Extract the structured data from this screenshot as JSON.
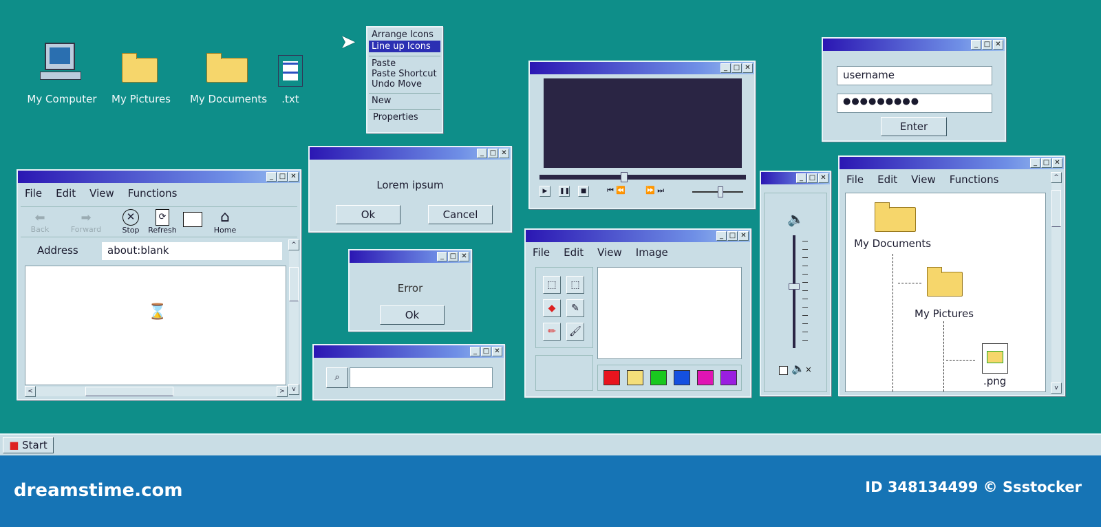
{
  "desktop_icons": [
    {
      "label": "My Computer"
    },
    {
      "label": "My Pictures"
    },
    {
      "label": "My Documents"
    },
    {
      "label": ".txt"
    }
  ],
  "context_menu": {
    "items": [
      "Arrange Icons",
      "Line up Icons",
      "Paste",
      "Paste Shortcut",
      "Undo Move",
      "New",
      "Properties"
    ]
  },
  "browser": {
    "menu": [
      "File",
      "Edit",
      "View",
      "Functions"
    ],
    "toolbar": [
      "Back",
      "Forward",
      "Stop",
      "Refresh",
      "Home"
    ],
    "address_label": "Address",
    "address_value": "about:blank"
  },
  "dialog": {
    "message": "Lorem ipsum",
    "ok": "Ok",
    "cancel": "Cancel"
  },
  "error": {
    "message": "Error",
    "ok": "Ok"
  },
  "search": {
    "value": ""
  },
  "player": {
    "progress": 0.41,
    "volume": 0.55
  },
  "paint": {
    "menu": [
      "File",
      "Edit",
      "View",
      "Image"
    ],
    "palette": [
      "#e8141e",
      "#f4de7a",
      "#19c81f",
      "#1450e0",
      "#e014b4",
      "#9a1ee0"
    ]
  },
  "volume": {
    "level": 0.55
  },
  "login": {
    "username": "username",
    "password": "●●●●●●●●●",
    "enter": "Enter"
  },
  "explorer": {
    "menu": [
      "File",
      "Edit",
      "View",
      "Functions"
    ],
    "items": [
      "My Documents",
      "My Pictures",
      ".png"
    ]
  },
  "taskbar": {
    "start": "Start"
  },
  "banner": {
    "brand": "dreamstime.com",
    "id": "ID 348134499 © Ssstocker"
  }
}
